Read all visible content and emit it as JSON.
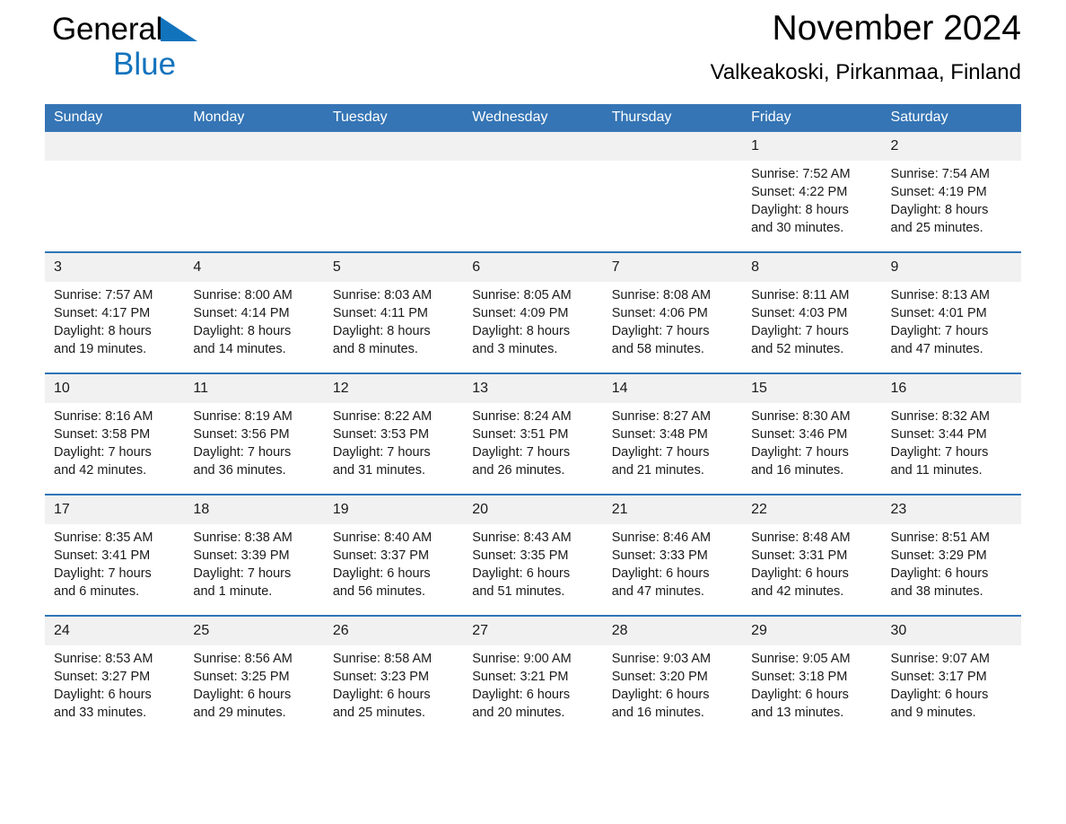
{
  "brand": {
    "name_part1": "General",
    "name_part2": "Blue"
  },
  "header": {
    "title": "November 2024",
    "subtitle": "Valkeakoski, Pirkanmaa, Finland"
  },
  "calendar": {
    "weekday_headers": [
      "Sunday",
      "Monday",
      "Tuesday",
      "Wednesday",
      "Thursday",
      "Friday",
      "Saturday"
    ],
    "accent_color": "#2e75b6",
    "header_bg_color": "#3575b5",
    "daynum_bg_color": "#f1f1f1",
    "weeks": [
      [
        {
          "day": "",
          "sunrise": "",
          "sunset": "",
          "daylight_line1": "",
          "daylight_line2": ""
        },
        {
          "day": "",
          "sunrise": "",
          "sunset": "",
          "daylight_line1": "",
          "daylight_line2": ""
        },
        {
          "day": "",
          "sunrise": "",
          "sunset": "",
          "daylight_line1": "",
          "daylight_line2": ""
        },
        {
          "day": "",
          "sunrise": "",
          "sunset": "",
          "daylight_line1": "",
          "daylight_line2": ""
        },
        {
          "day": "",
          "sunrise": "",
          "sunset": "",
          "daylight_line1": "",
          "daylight_line2": ""
        },
        {
          "day": "1",
          "sunrise": "Sunrise: 7:52 AM",
          "sunset": "Sunset: 4:22 PM",
          "daylight_line1": "Daylight: 8 hours",
          "daylight_line2": "and 30 minutes."
        },
        {
          "day": "2",
          "sunrise": "Sunrise: 7:54 AM",
          "sunset": "Sunset: 4:19 PM",
          "daylight_line1": "Daylight: 8 hours",
          "daylight_line2": "and 25 minutes."
        }
      ],
      [
        {
          "day": "3",
          "sunrise": "Sunrise: 7:57 AM",
          "sunset": "Sunset: 4:17 PM",
          "daylight_line1": "Daylight: 8 hours",
          "daylight_line2": "and 19 minutes."
        },
        {
          "day": "4",
          "sunrise": "Sunrise: 8:00 AM",
          "sunset": "Sunset: 4:14 PM",
          "daylight_line1": "Daylight: 8 hours",
          "daylight_line2": "and 14 minutes."
        },
        {
          "day": "5",
          "sunrise": "Sunrise: 8:03 AM",
          "sunset": "Sunset: 4:11 PM",
          "daylight_line1": "Daylight: 8 hours",
          "daylight_line2": "and 8 minutes."
        },
        {
          "day": "6",
          "sunrise": "Sunrise: 8:05 AM",
          "sunset": "Sunset: 4:09 PM",
          "daylight_line1": "Daylight: 8 hours",
          "daylight_line2": "and 3 minutes."
        },
        {
          "day": "7",
          "sunrise": "Sunrise: 8:08 AM",
          "sunset": "Sunset: 4:06 PM",
          "daylight_line1": "Daylight: 7 hours",
          "daylight_line2": "and 58 minutes."
        },
        {
          "day": "8",
          "sunrise": "Sunrise: 8:11 AM",
          "sunset": "Sunset: 4:03 PM",
          "daylight_line1": "Daylight: 7 hours",
          "daylight_line2": "and 52 minutes."
        },
        {
          "day": "9",
          "sunrise": "Sunrise: 8:13 AM",
          "sunset": "Sunset: 4:01 PM",
          "daylight_line1": "Daylight: 7 hours",
          "daylight_line2": "and 47 minutes."
        }
      ],
      [
        {
          "day": "10",
          "sunrise": "Sunrise: 8:16 AM",
          "sunset": "Sunset: 3:58 PM",
          "daylight_line1": "Daylight: 7 hours",
          "daylight_line2": "and 42 minutes."
        },
        {
          "day": "11",
          "sunrise": "Sunrise: 8:19 AM",
          "sunset": "Sunset: 3:56 PM",
          "daylight_line1": "Daylight: 7 hours",
          "daylight_line2": "and 36 minutes."
        },
        {
          "day": "12",
          "sunrise": "Sunrise: 8:22 AM",
          "sunset": "Sunset: 3:53 PM",
          "daylight_line1": "Daylight: 7 hours",
          "daylight_line2": "and 31 minutes."
        },
        {
          "day": "13",
          "sunrise": "Sunrise: 8:24 AM",
          "sunset": "Sunset: 3:51 PM",
          "daylight_line1": "Daylight: 7 hours",
          "daylight_line2": "and 26 minutes."
        },
        {
          "day": "14",
          "sunrise": "Sunrise: 8:27 AM",
          "sunset": "Sunset: 3:48 PM",
          "daylight_line1": "Daylight: 7 hours",
          "daylight_line2": "and 21 minutes."
        },
        {
          "day": "15",
          "sunrise": "Sunrise: 8:30 AM",
          "sunset": "Sunset: 3:46 PM",
          "daylight_line1": "Daylight: 7 hours",
          "daylight_line2": "and 16 minutes."
        },
        {
          "day": "16",
          "sunrise": "Sunrise: 8:32 AM",
          "sunset": "Sunset: 3:44 PM",
          "daylight_line1": "Daylight: 7 hours",
          "daylight_line2": "and 11 minutes."
        }
      ],
      [
        {
          "day": "17",
          "sunrise": "Sunrise: 8:35 AM",
          "sunset": "Sunset: 3:41 PM",
          "daylight_line1": "Daylight: 7 hours",
          "daylight_line2": "and 6 minutes."
        },
        {
          "day": "18",
          "sunrise": "Sunrise: 8:38 AM",
          "sunset": "Sunset: 3:39 PM",
          "daylight_line1": "Daylight: 7 hours",
          "daylight_line2": "and 1 minute."
        },
        {
          "day": "19",
          "sunrise": "Sunrise: 8:40 AM",
          "sunset": "Sunset: 3:37 PM",
          "daylight_line1": "Daylight: 6 hours",
          "daylight_line2": "and 56 minutes."
        },
        {
          "day": "20",
          "sunrise": "Sunrise: 8:43 AM",
          "sunset": "Sunset: 3:35 PM",
          "daylight_line1": "Daylight: 6 hours",
          "daylight_line2": "and 51 minutes."
        },
        {
          "day": "21",
          "sunrise": "Sunrise: 8:46 AM",
          "sunset": "Sunset: 3:33 PM",
          "daylight_line1": "Daylight: 6 hours",
          "daylight_line2": "and 47 minutes."
        },
        {
          "day": "22",
          "sunrise": "Sunrise: 8:48 AM",
          "sunset": "Sunset: 3:31 PM",
          "daylight_line1": "Daylight: 6 hours",
          "daylight_line2": "and 42 minutes."
        },
        {
          "day": "23",
          "sunrise": "Sunrise: 8:51 AM",
          "sunset": "Sunset: 3:29 PM",
          "daylight_line1": "Daylight: 6 hours",
          "daylight_line2": "and 38 minutes."
        }
      ],
      [
        {
          "day": "24",
          "sunrise": "Sunrise: 8:53 AM",
          "sunset": "Sunset: 3:27 PM",
          "daylight_line1": "Daylight: 6 hours",
          "daylight_line2": "and 33 minutes."
        },
        {
          "day": "25",
          "sunrise": "Sunrise: 8:56 AM",
          "sunset": "Sunset: 3:25 PM",
          "daylight_line1": "Daylight: 6 hours",
          "daylight_line2": "and 29 minutes."
        },
        {
          "day": "26",
          "sunrise": "Sunrise: 8:58 AM",
          "sunset": "Sunset: 3:23 PM",
          "daylight_line1": "Daylight: 6 hours",
          "daylight_line2": "and 25 minutes."
        },
        {
          "day": "27",
          "sunrise": "Sunrise: 9:00 AM",
          "sunset": "Sunset: 3:21 PM",
          "daylight_line1": "Daylight: 6 hours",
          "daylight_line2": "and 20 minutes."
        },
        {
          "day": "28",
          "sunrise": "Sunrise: 9:03 AM",
          "sunset": "Sunset: 3:20 PM",
          "daylight_line1": "Daylight: 6 hours",
          "daylight_line2": "and 16 minutes."
        },
        {
          "day": "29",
          "sunrise": "Sunrise: 9:05 AM",
          "sunset": "Sunset: 3:18 PM",
          "daylight_line1": "Daylight: 6 hours",
          "daylight_line2": "and 13 minutes."
        },
        {
          "day": "30",
          "sunrise": "Sunrise: 9:07 AM",
          "sunset": "Sunset: 3:17 PM",
          "daylight_line1": "Daylight: 6 hours",
          "daylight_line2": "and 9 minutes."
        }
      ]
    ]
  }
}
